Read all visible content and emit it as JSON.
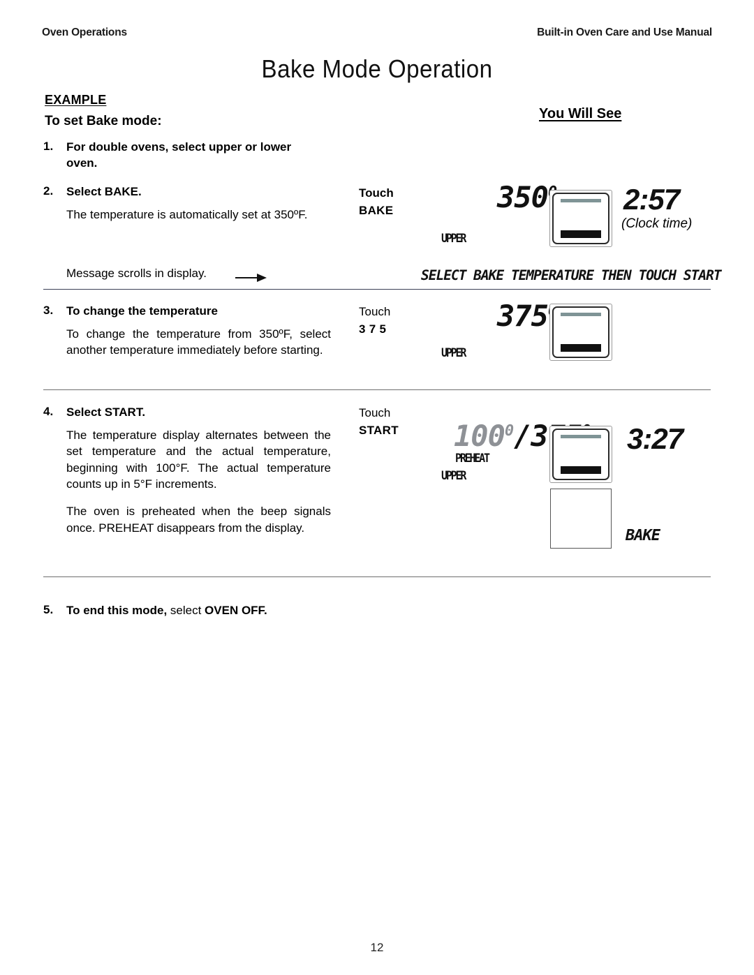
{
  "header": {
    "left": "Oven Operations",
    "right": "Built-in Oven Care and Use Manual"
  },
  "page_title": "Bake Mode Operation",
  "example_label": "EXAMPLE",
  "subhead": "To set Bake mode:",
  "you_will_see": "You Will See",
  "steps": [
    {
      "number": "1.",
      "title": "For double ovens, select upper or lower oven."
    },
    {
      "number": "2.",
      "title": "Select BAKE.",
      "paragraph": "The temperature is automatically set at 350ºF.",
      "touch_line1": "Touch",
      "touch_line2": "BAKE"
    },
    {
      "number": "3.",
      "title": "To change the temperature",
      "paragraph": "To change the temperature from 350ºF, select another temperature immediately before starting.",
      "touch_line1": "Touch",
      "touch_line2": "3 7 5"
    },
    {
      "number": "4.",
      "title": "Select  START.",
      "paragraph1": "The temperature display alternates between the set temperature and the actual temperature, beginning with 100°F.  The actual temperature counts up in 5°F increments.",
      "paragraph2": "The oven is preheated when the beep signals once.  PREHEAT disappears from the display.",
      "touch_line1": "Touch",
      "touch_line2": "START"
    },
    {
      "number": "5.",
      "title_bold": "To end this mode,",
      "title_rest": " select ",
      "title_bold2": "OVEN OFF."
    }
  ],
  "scroll_message": {
    "left_text": "Message scrolls in display.",
    "arrow": "right-arrow-icon",
    "display_text": "SELECT BAKE TEMPERATURE THEN TOUCH START"
  },
  "displays": {
    "step2": {
      "temperature": "350",
      "degree": "0",
      "oven_label": "UPPER",
      "clock": "2:57",
      "clock_caption": "(Clock time)"
    },
    "step3": {
      "temperature": "375",
      "degree": "0",
      "oven_label": "UPPER"
    },
    "step4": {
      "actual_temperature": "100",
      "actual_degree": "0",
      "separator": "/",
      "set_temperature": "375",
      "set_degree": "0",
      "preheat_label": "PREHEAT",
      "oven_label": "UPPER",
      "clock": "3:27",
      "mode_label": "BAKE"
    }
  },
  "folio": "12",
  "colors": {
    "rule_dark": "#3a3f55",
    "rule_gray": "#6e6e6e",
    "lcd_bar_top": "#7f9496",
    "lcd_bar_bottom": "#111111",
    "dim_digit": "#8e9196",
    "text": "#000000"
  }
}
